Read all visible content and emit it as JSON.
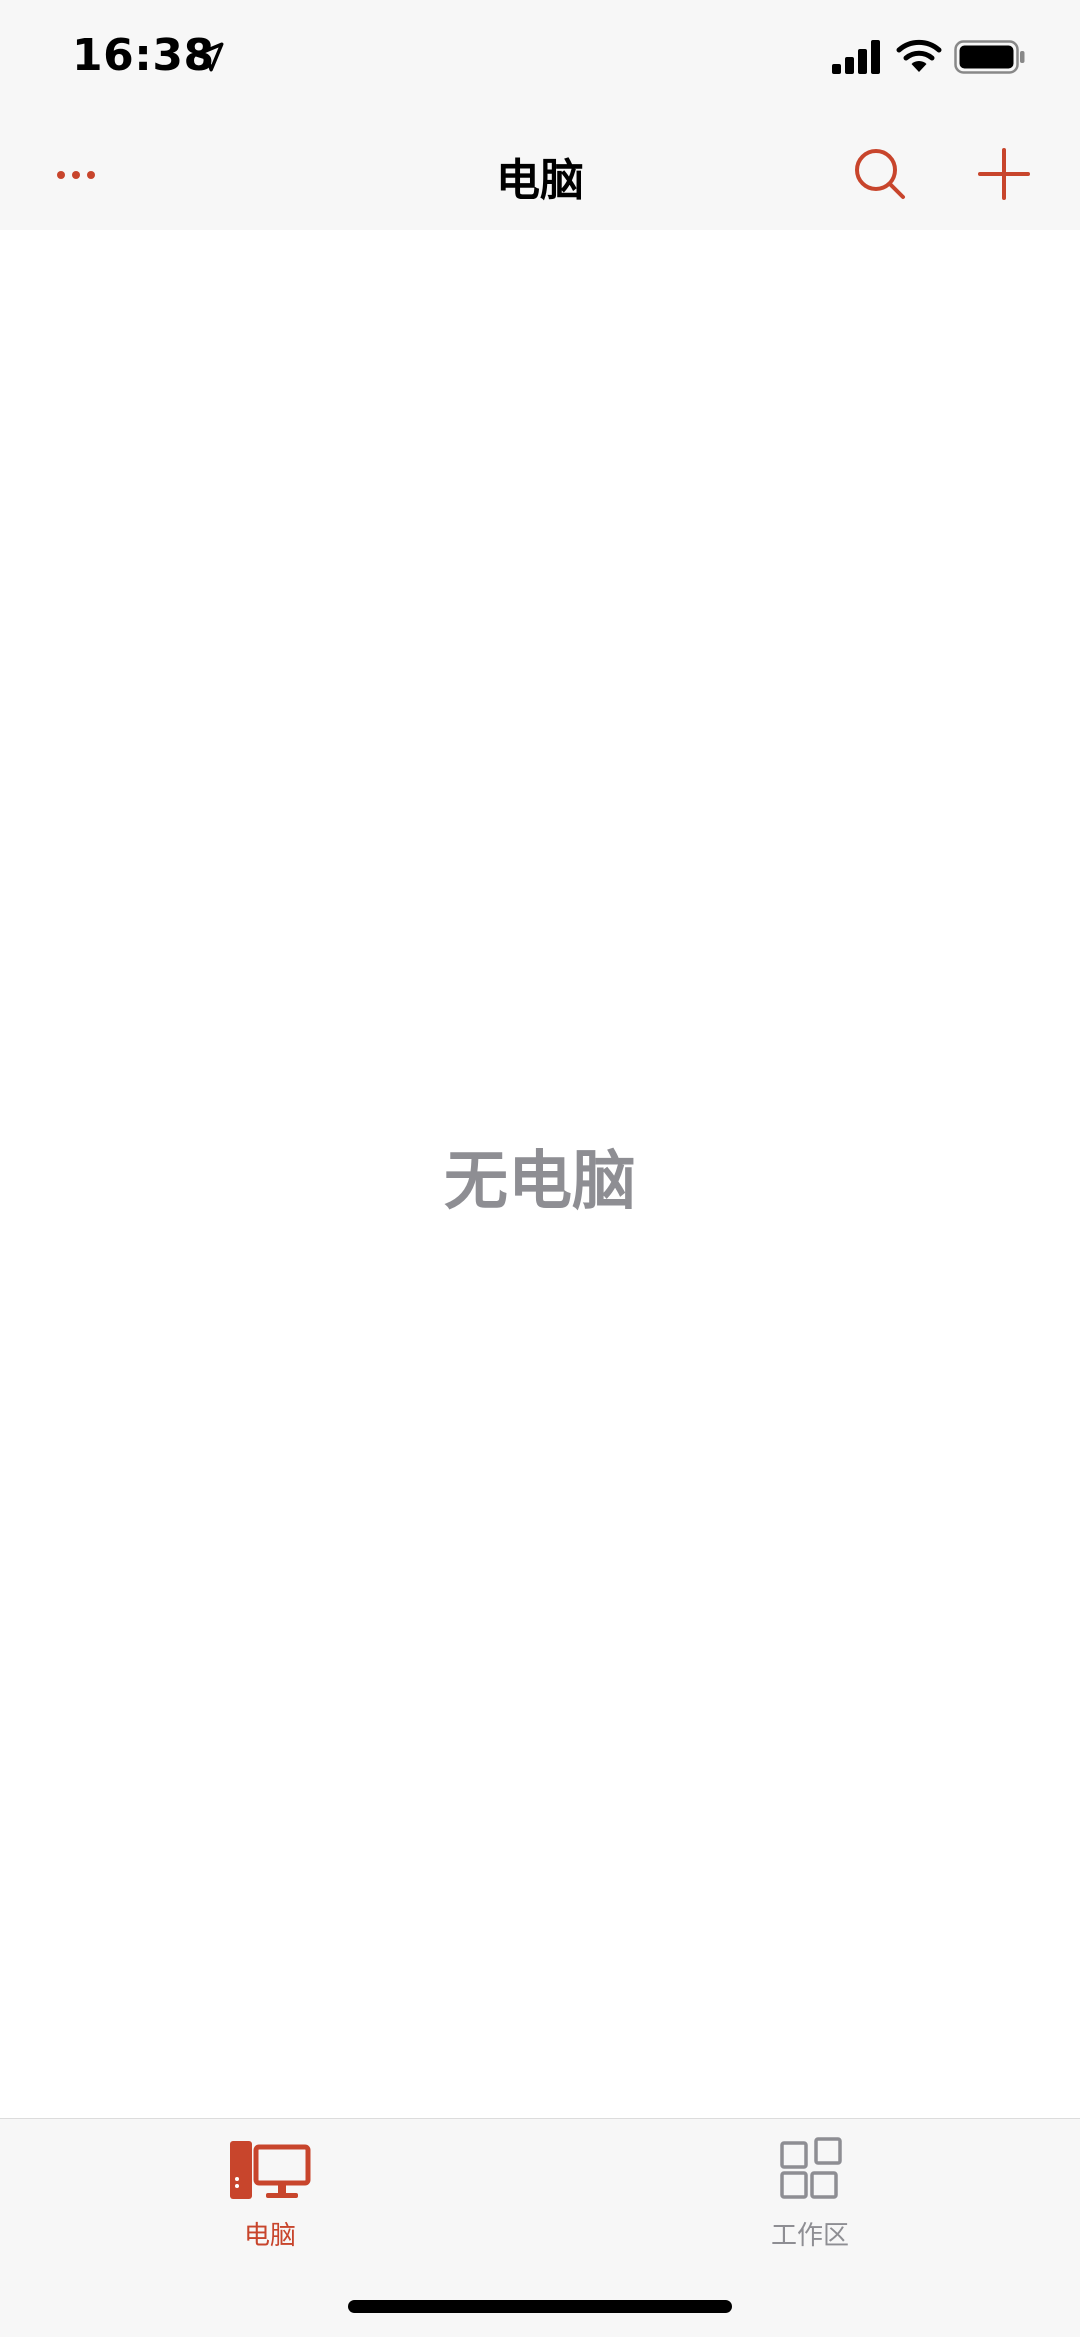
{
  "status_bar": {
    "time": "16:38",
    "icons": [
      "location-arrow-icon",
      "cellular-signal-icon",
      "wifi-icon",
      "battery-icon"
    ]
  },
  "nav": {
    "title": "电脑",
    "more_icon": "ellipsis-icon",
    "search_icon": "search-icon",
    "add_icon": "plus-icon"
  },
  "content": {
    "empty_message": "无电脑"
  },
  "tabs": [
    {
      "label": "电脑",
      "icon": "computer-icon",
      "selected": true
    },
    {
      "label": "工作区",
      "icon": "workspace-grid-icon",
      "selected": false
    }
  ],
  "colors": {
    "accent": "#c8452c",
    "inactive": "#8e8e93",
    "bar_background": "#f7f7f7",
    "empty_text": "#8e8e93"
  }
}
